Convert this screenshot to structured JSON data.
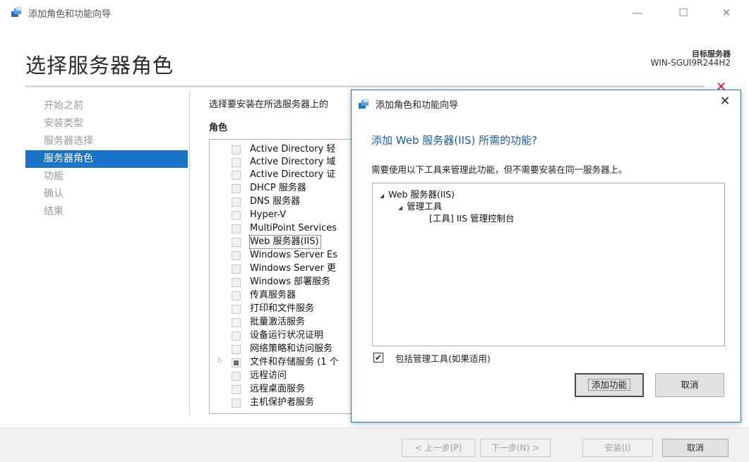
{
  "window": {
    "title": "添加角色和功能向导",
    "minimize_glyph": "—",
    "maximize_glyph": "☐",
    "close_glyph": "✕"
  },
  "page": {
    "title": "选择服务器角色",
    "target_label": "目标服务器",
    "target_name": "WIN-SGUI9R244H2",
    "alert_glyph": "✕"
  },
  "nav": {
    "items": [
      {
        "label": "开始之前",
        "active": false
      },
      {
        "label": "安装类型",
        "active": false
      },
      {
        "label": "服务器选择",
        "active": false
      },
      {
        "label": "服务器角色",
        "active": true
      },
      {
        "label": "功能",
        "active": false
      },
      {
        "label": "确认",
        "active": false
      },
      {
        "label": "结果",
        "active": false
      }
    ]
  },
  "roles": {
    "instruction": "选择要安装在所选服务器上的",
    "heading": "角色",
    "items": [
      {
        "label": "Active Directory 轻",
        "state": "unchecked"
      },
      {
        "label": "Active Directory 域",
        "state": "unchecked"
      },
      {
        "label": "Active Directory 证",
        "state": "unchecked"
      },
      {
        "label": "DHCP 服务器",
        "state": "unchecked"
      },
      {
        "label": "DNS 服务器",
        "state": "unchecked"
      },
      {
        "label": "Hyper-V",
        "state": "unchecked"
      },
      {
        "label": "MultiPoint Services",
        "state": "unchecked"
      },
      {
        "label": "Web 服务器(IIS)",
        "state": "unchecked",
        "selected": true
      },
      {
        "label": "Windows Server Es",
        "state": "unchecked"
      },
      {
        "label": "Windows Server 更",
        "state": "unchecked"
      },
      {
        "label": "Windows 部署服务",
        "state": "unchecked"
      },
      {
        "label": "传真服务器",
        "state": "unchecked"
      },
      {
        "label": "打印和文件服务",
        "state": "unchecked"
      },
      {
        "label": "批量激活服务",
        "state": "unchecked"
      },
      {
        "label": "设备运行状况证明",
        "state": "unchecked"
      },
      {
        "label": "网络策略和访问服务",
        "state": "unchecked"
      },
      {
        "label": "文件和存储服务 (1 个",
        "state": "partial",
        "expander": "▷"
      },
      {
        "label": "远程访问",
        "state": "unchecked"
      },
      {
        "label": "远程桌面服务",
        "state": "unchecked"
      },
      {
        "label": "主机保护者服务",
        "state": "unchecked"
      }
    ]
  },
  "footer": {
    "prev_label": "< 上一步(P)",
    "next_label": "下一步(N) >",
    "install_label": "安装(I)",
    "cancel_label": "取消"
  },
  "dialog": {
    "title": "添加角色和功能向导",
    "close_glyph": "✕",
    "heading": "添加 Web 服务器(IIS) 所需的功能?",
    "description": "需要使用以下工具来管理此功能，但不需要安装在同一服务器上。",
    "tree": [
      {
        "label": "Web 服务器(IIS)",
        "level": 0,
        "expander": "◢"
      },
      {
        "label": "管理工具",
        "level": 1,
        "expander": "◢"
      },
      {
        "label": "[工具] IIS 管理控制台",
        "level": 2,
        "expander": ""
      }
    ],
    "include_tools_checked": true,
    "check_glyph": "✔",
    "include_tools_label": "包括管理工具(如果适用)",
    "add_features_label": "添加功能",
    "cancel_label": "取消"
  },
  "colors": {
    "accent": "#1a73c7",
    "dialog_heading": "#1a5fa8",
    "alert": "#e81123"
  }
}
